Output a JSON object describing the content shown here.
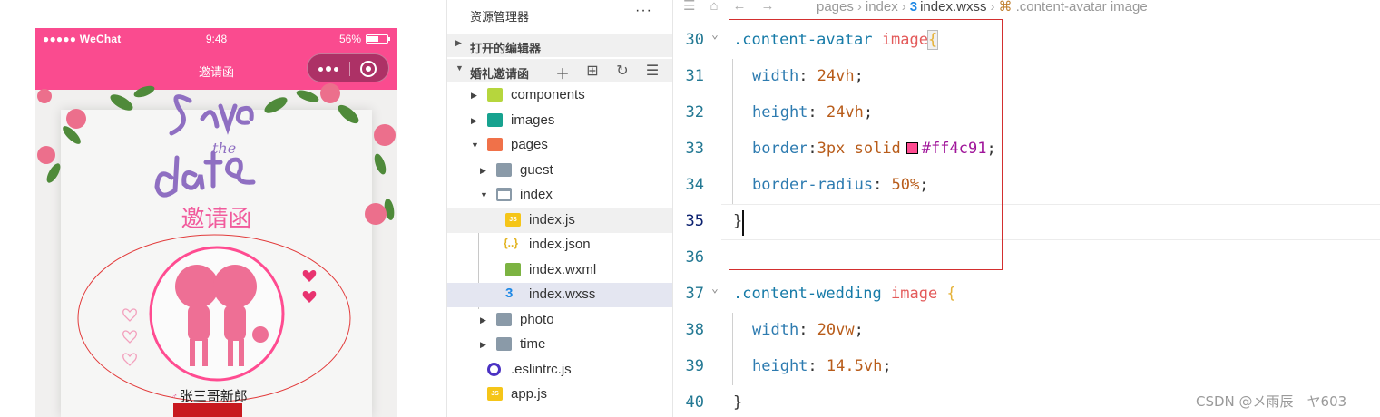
{
  "phone": {
    "status_left": "●●●●● WeChat",
    "status_time": "9:48",
    "status_battery": "56%",
    "nav_title": "邀请函",
    "invite_title": "邀请函",
    "names": "张三哥新郎",
    "colors": {
      "brand_pink": "#fa4b8f",
      "title_pink": "#f15a9c",
      "avatar_border": "#ff4c91"
    }
  },
  "explorer": {
    "title": "资源管理器",
    "more": "···",
    "open_editors_label": "打开的编辑器",
    "project_label": "婚礼邀请函",
    "project_actions": [
      "new-file-icon",
      "new-folder-icon",
      "refresh-icon",
      "collapse-icon"
    ],
    "tree": [
      {
        "name": "components",
        "icon": "folder-components-icon"
      },
      {
        "name": "images",
        "icon": "folder-images-icon"
      },
      {
        "name": "pages",
        "icon": "folder-pages-icon"
      },
      {
        "name": "guest",
        "icon": "folder-icon"
      },
      {
        "name": "index",
        "icon": "folder-open-icon"
      },
      {
        "name": "index.js",
        "icon": "js-file-icon"
      },
      {
        "name": "index.json",
        "icon": "json-file-icon"
      },
      {
        "name": "index.wxml",
        "icon": "wxml-file-icon"
      },
      {
        "name": "index.wxss",
        "icon": "wxss-file-icon"
      },
      {
        "name": "photo",
        "icon": "folder-icon"
      },
      {
        "name": "time",
        "icon": "folder-icon"
      },
      {
        "name": ".eslintrc.js",
        "icon": "eslint-file-icon"
      },
      {
        "name": "app.js",
        "icon": "js-file-icon"
      }
    ]
  },
  "editor": {
    "breadcrumb": [
      "pages",
      "index",
      "index.wxss",
      ".content-avatar image"
    ],
    "lines": [
      {
        "num": "30",
        "code": ".content-avatar image{"
      },
      {
        "num": "31",
        "code": "width: 24vh;"
      },
      {
        "num": "32",
        "code": "height: 24vh;"
      },
      {
        "num": "33",
        "code": "border:3px solid #ff4c91;"
      },
      {
        "num": "34",
        "code": "border-radius: 50%;"
      },
      {
        "num": "35",
        "code": "}"
      },
      {
        "num": "36",
        "code": ""
      },
      {
        "num": "37",
        "code": ".content-wedding image {"
      },
      {
        "num": "38",
        "code": "width: 20vw;"
      },
      {
        "num": "39",
        "code": "height: 14.5vh;"
      },
      {
        "num": "40",
        "code": "}"
      }
    ],
    "swatch_color": "#ff4c91"
  },
  "watermark": "CSDN @メ雨辰　ヤ603"
}
